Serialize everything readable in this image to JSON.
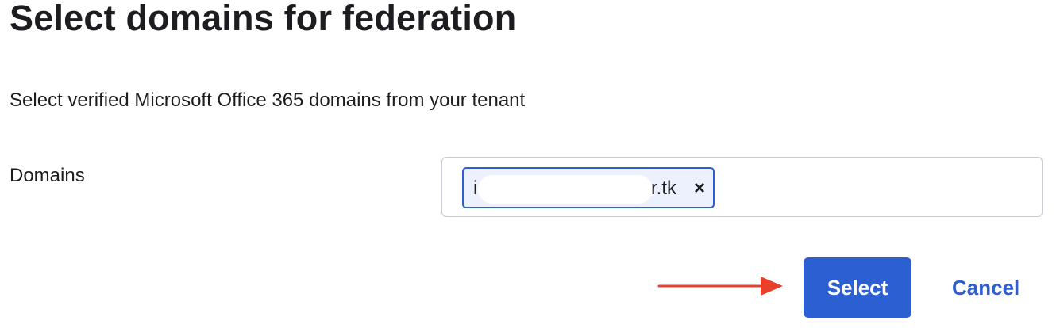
{
  "dialog": {
    "title": "Select domains for federation",
    "subtitle": "Select verified Microsoft Office 365 domains from your tenant"
  },
  "domains_field": {
    "label": "Domains",
    "chips": [
      {
        "visible_prefix": "i",
        "visible_suffix": "r.tk",
        "remove_glyph": "×",
        "remove_icon": "close-icon"
      }
    ]
  },
  "actions": {
    "select_label": "Select",
    "cancel_label": "Cancel",
    "annotation_icon": "arrow-right-icon"
  },
  "colors": {
    "accent": "#2c5fd1",
    "chip_background": "#edf1fd",
    "annotation_arrow": "#e8402a",
    "text": "#1d1d21",
    "input_border": "#c9cbd2"
  }
}
